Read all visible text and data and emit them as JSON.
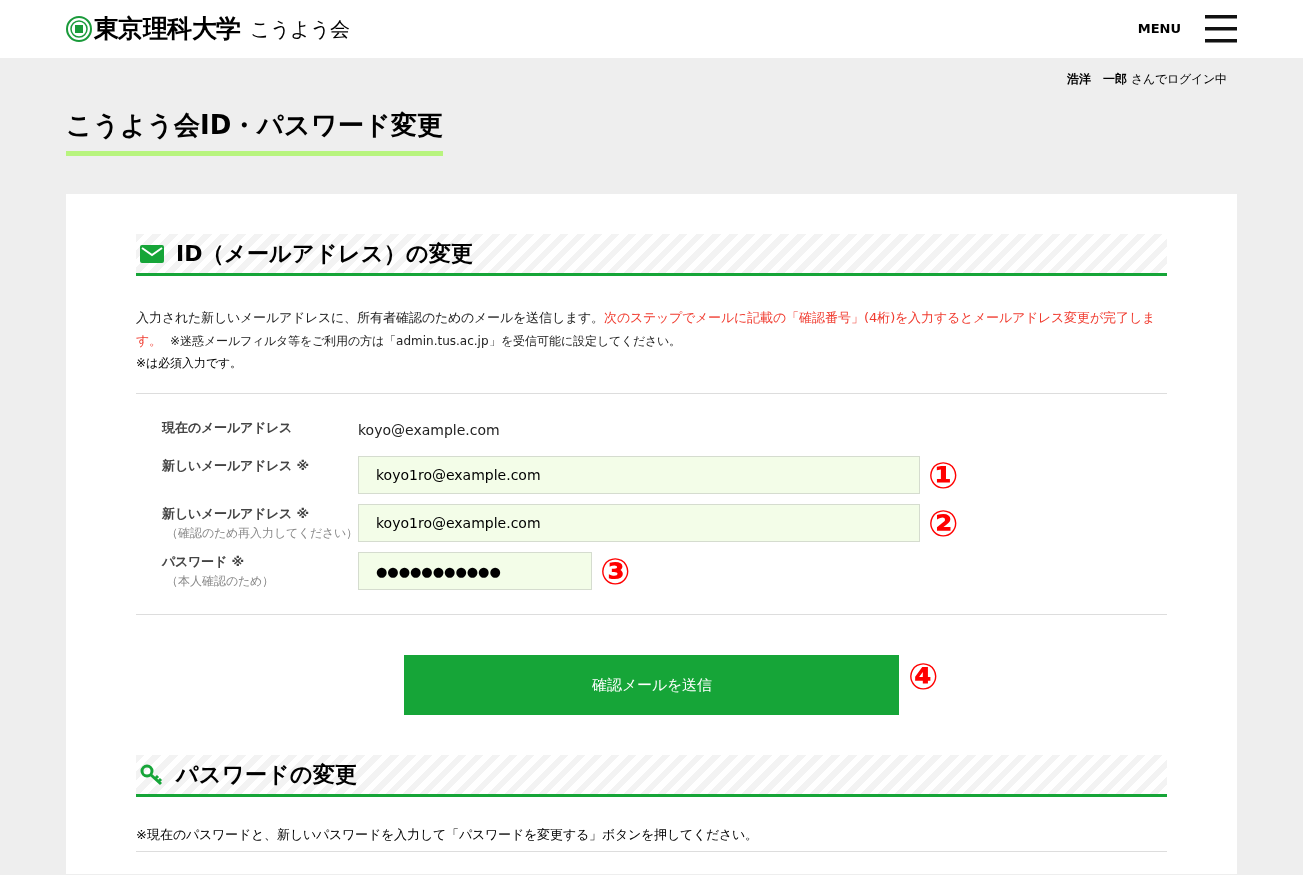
{
  "header": {
    "logo_text": "東京理科大学",
    "logo_sub": "こうよう会",
    "menu_label": "MENU"
  },
  "login": {
    "name": "浩洋　一郎",
    "suffix": "さんでログイン中"
  },
  "page_title": "こうよう会ID・パスワード変更",
  "email_section": {
    "title": "ID（メールアドレス）の変更",
    "intro": "入力された新しいメールアドレスに、所有者確認のためのメールを送信します。",
    "warning": "次のステップでメールに記載の「確認番号」(4桁)を入力するとメールアドレス変更が完了します。",
    "note": "※迷惑メールフィルタ等をご利用の方は「admin.tus.ac.jp」を受信可能に設定してください。",
    "required_note": "※は必須入力です。",
    "fields": [
      {
        "kind": "static",
        "label": "現在のメールアドレス",
        "value": "koyo@example.com"
      },
      {
        "kind": "input",
        "label": "新しいメールアドレス ※",
        "value": "koyo1ro@example.com",
        "annotation": "①"
      },
      {
        "kind": "input",
        "label": "新しいメールアドレス ※",
        "hint": "（確認のため再入力してください）",
        "value": "koyo1ro@example.com",
        "annotation": "②"
      },
      {
        "kind": "password",
        "label": "パスワード ※",
        "hint": "（本人確認のため）",
        "value": "●●●●●●●●●●●",
        "annotation": "③"
      }
    ],
    "button": {
      "label": "確認メールを送信",
      "annotation": "④"
    }
  },
  "password_section": {
    "title": "パスワードの変更",
    "intro": "※現在のパスワードと、新しいパスワードを入力して「パスワードを変更する」ボタンを押してください。"
  }
}
